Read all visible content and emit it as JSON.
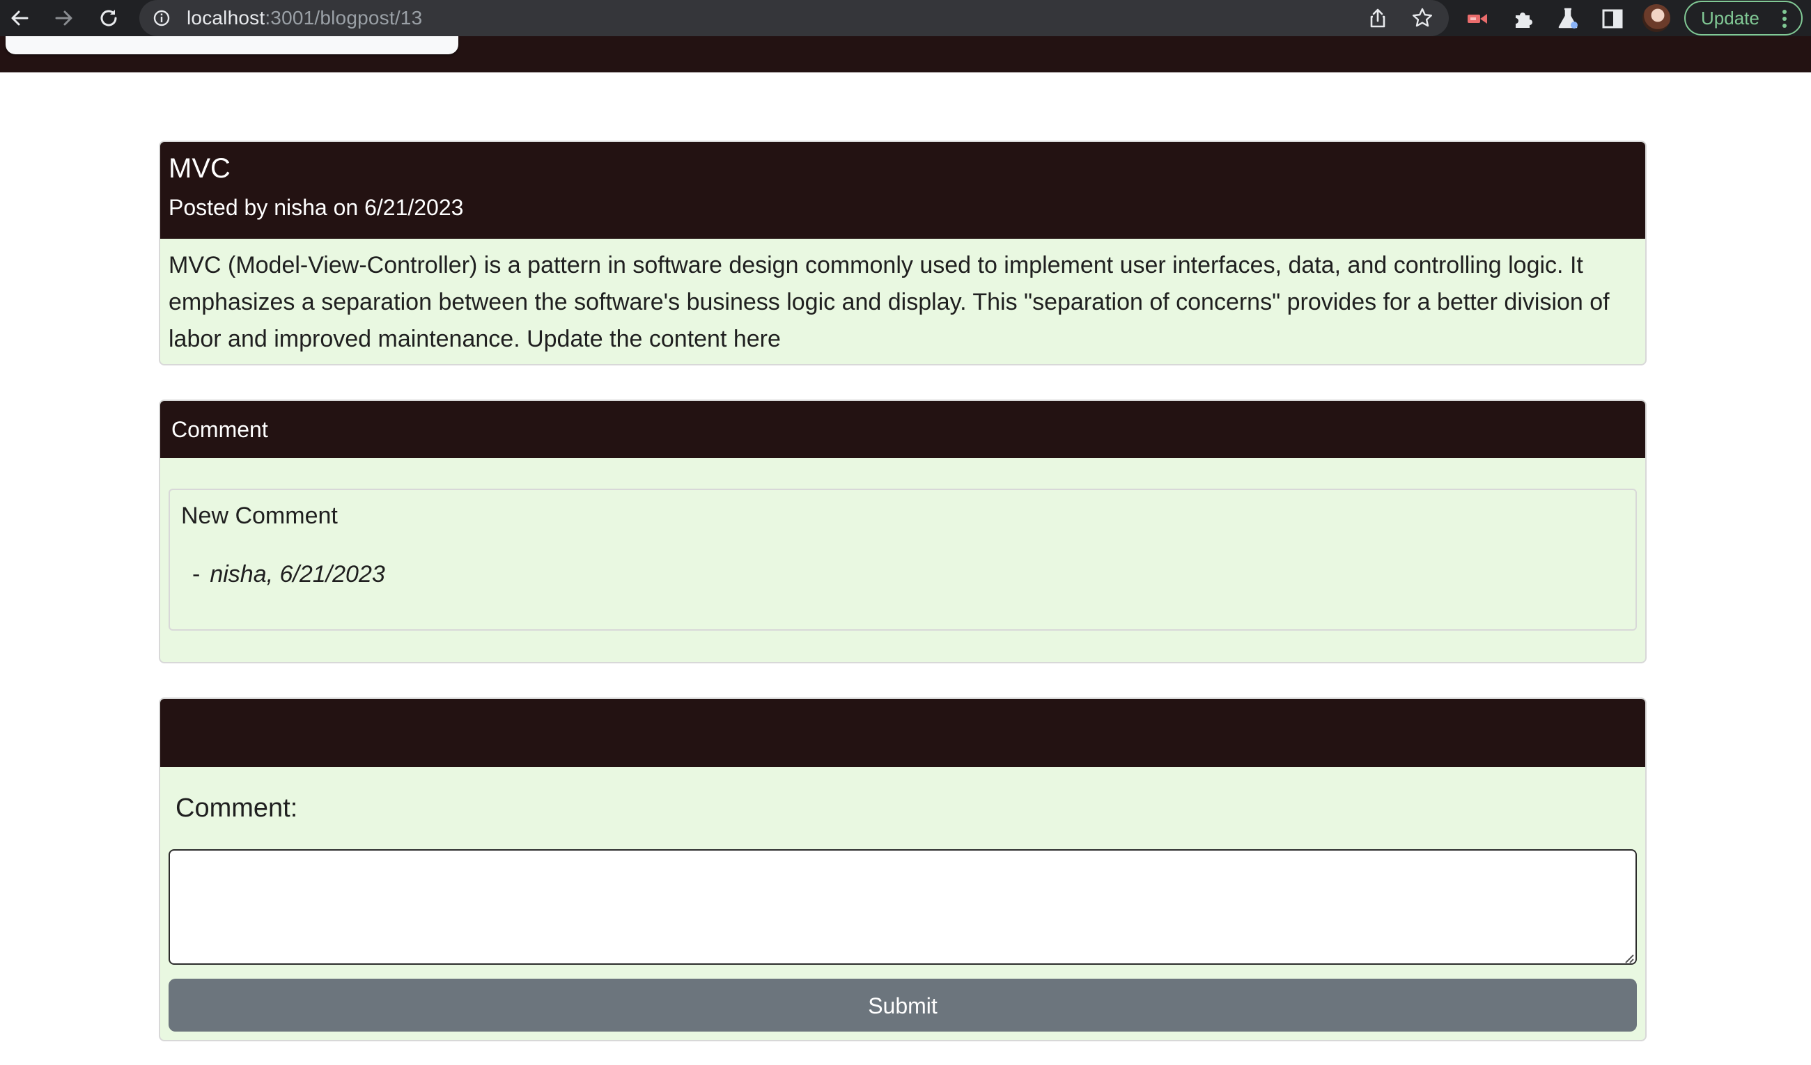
{
  "browser": {
    "url_host": "localhost",
    "url_path": ":3001/blogpost/13",
    "update_label": "Update",
    "icons": [
      "back-arrow-icon",
      "forward-arrow-icon",
      "reload-icon",
      "info-icon",
      "share-icon",
      "bookmark-star-icon",
      "recorder-extension-icon",
      "puzzle-extensions-icon",
      "labs-flask-icon",
      "side-panel-icon",
      "profile-avatar",
      "kebab-menu-icon"
    ]
  },
  "post": {
    "title": "MVC",
    "meta": "Posted by nisha on 6/21/2023",
    "body": "MVC (Model-View-Controller) is a pattern in software design commonly used to implement user interfaces, data, and controlling logic. It emphasizes a separation between the software's business logic and display. This \"separation of concerns\" provides for a better division of labor and improved maintenance. Update the content here"
  },
  "comments": {
    "header": "Comment",
    "items": [
      {
        "text": "New Comment",
        "dash": "-",
        "footer": "nisha, 6/21/2023"
      }
    ]
  },
  "form": {
    "header": "",
    "label": "Comment:",
    "textarea_value": "",
    "submit_label": "Submit"
  },
  "colors": {
    "header_bg": "#231212",
    "card_bg": "#e9f8e1",
    "submit_bg": "#6c757d",
    "chrome_bg": "#202124",
    "update_accent": "#81c995"
  }
}
